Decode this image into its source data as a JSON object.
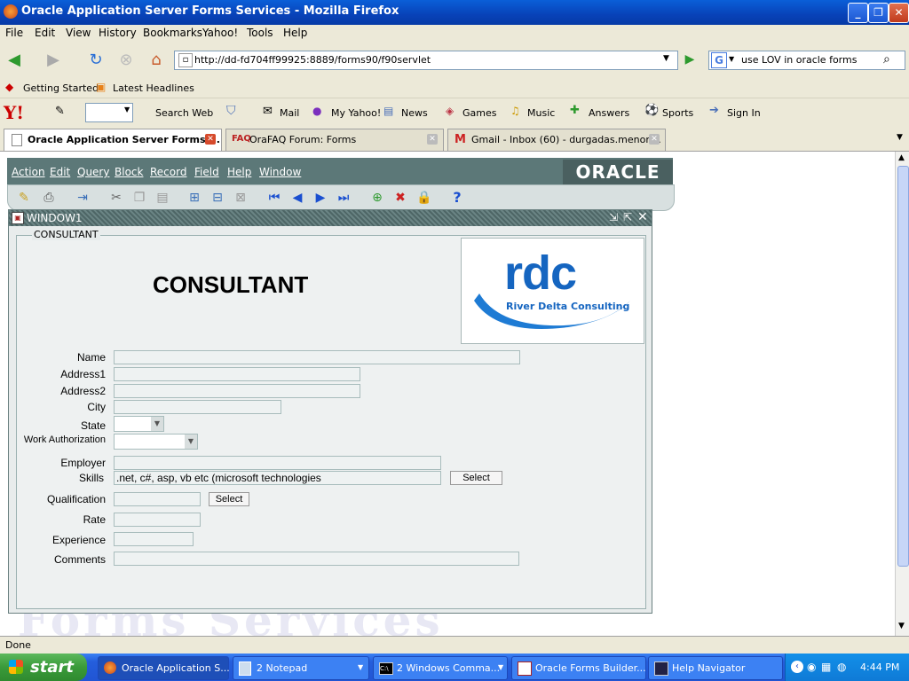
{
  "window": {
    "title": "Oracle Application Server Forms Services - Mozilla Firefox"
  },
  "menubar": [
    "File",
    "Edit",
    "View",
    "History",
    "Bookmarks",
    "Yahoo!",
    "Tools",
    "Help"
  ],
  "nav": {
    "url": "http://dd-fd704ff99925:8889/forms90/f90servlet",
    "search": "use LOV in oracle forms"
  },
  "bookmarks": [
    "Getting Started",
    "Latest Headlines"
  ],
  "yahoo": {
    "search_web": "Search Web",
    "items": [
      "Mail",
      "My Yahoo!",
      "News",
      "Games",
      "Music",
      "Answers",
      "Sports",
      "Sign In"
    ]
  },
  "tabs": [
    {
      "label": "Oracle Application Server Forms ...",
      "active": true
    },
    {
      "label": "OraFAQ Forum: Forms",
      "active": false
    },
    {
      "label": "Gmail - Inbox (60) - durgadas.menon...",
      "active": false
    }
  ],
  "forms": {
    "menu": [
      "Action",
      "Edit",
      "Query",
      "Block",
      "Record",
      "Field",
      "Help",
      "Window"
    ],
    "oracle_logo": "ORACLE",
    "window_title": "WINDOW1",
    "frame_legend": "CONSULTANT",
    "heading": "CONSULTANT",
    "logo": {
      "main": "rdc",
      "sub": "River Delta Consulting"
    },
    "labels": {
      "name": "Name",
      "address1": "Address1",
      "address2": "Address2",
      "city": "City",
      "state": "State",
      "work_auth": "Work Authorization",
      "employer": "Employer",
      "skills": "Skills",
      "qualification": "Qualification",
      "rate": "Rate",
      "experience": "Experience",
      "comments": "Comments"
    },
    "values": {
      "skills": ".net, c#, asp, vb etc (microsoft technologies"
    },
    "select_label": "Select",
    "watermark": "Forms Services"
  },
  "status": "Done",
  "taskbar": {
    "start": "start",
    "tasks": [
      "Oracle Application S...",
      "2 Notepad",
      "2 Windows Comma...",
      "Oracle Forms Builder...",
      "Help Navigator"
    ],
    "clock": "4:44 PM"
  }
}
